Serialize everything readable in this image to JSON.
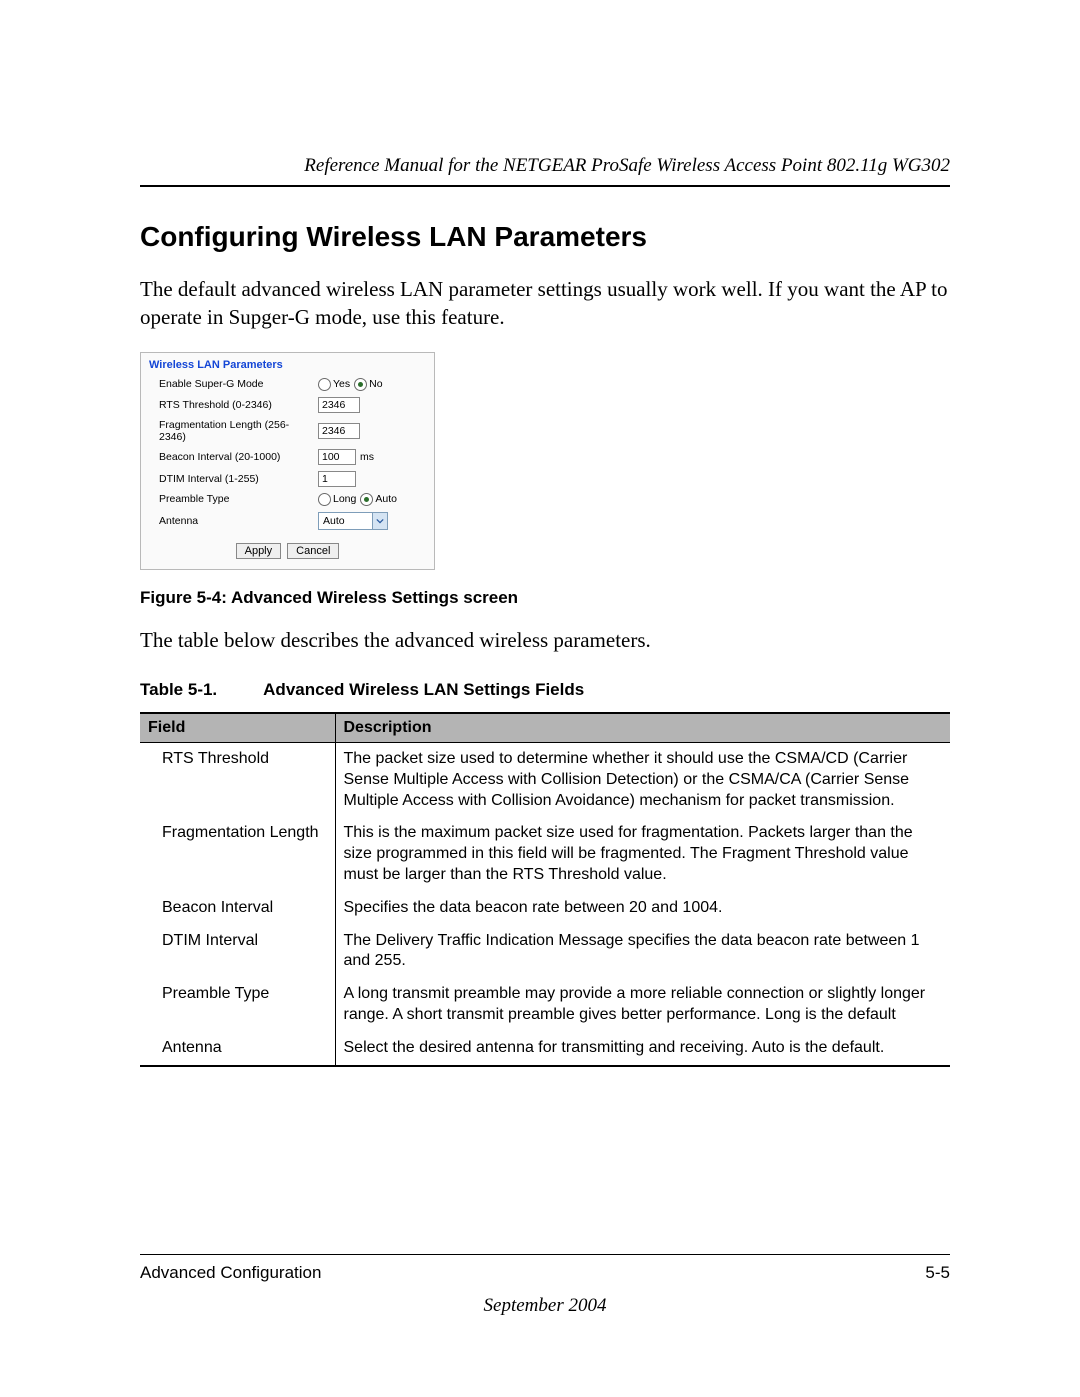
{
  "header": {
    "running_title": "Reference Manual for the NETGEAR ProSafe Wireless Access Point 802.11g WG302"
  },
  "heading": "Configuring Wireless LAN Parameters",
  "intro_para": "The default advanced wireless LAN parameter settings usually work well. If you want the AP to operate in Supger-G mode, use this feature.",
  "panel": {
    "title": "Wireless LAN Parameters",
    "rows": {
      "super_g": {
        "label": "Enable Super-G Mode",
        "yes": "Yes",
        "no": "No"
      },
      "rts": {
        "label": "RTS Threshold (0-2346)",
        "value": "2346"
      },
      "frag": {
        "label": "Fragmentation Length (256-2346)",
        "value": "2346"
      },
      "beacon": {
        "label": "Beacon Interval (20-1000)",
        "value": "100",
        "unit": "ms"
      },
      "dtim": {
        "label": "DTIM Interval (1-255)",
        "value": "1"
      },
      "preamble": {
        "label": "Preamble Type",
        "long": "Long",
        "auto": "Auto"
      },
      "antenna": {
        "label": "Antenna",
        "value": "Auto"
      }
    },
    "buttons": {
      "apply": "Apply",
      "cancel": "Cancel"
    }
  },
  "figure_caption": "Figure 5-4: Advanced Wireless Settings screen",
  "table_intro": "The table below describes the advanced wireless parameters.",
  "table_caption": {
    "num": "Table 5-1.",
    "title": "Advanced Wireless LAN Settings Fields"
  },
  "table": {
    "headers": {
      "field": "Field",
      "description": "Description"
    },
    "rows": [
      {
        "field": "RTS Threshold",
        "desc": "The packet size used to determine whether it should use the CSMA/CD (Carrier Sense Multiple Access with Collision Detection) or the CSMA/CA (Carrier Sense Multiple Access with Collision Avoidance) mechanism for packet transmission."
      },
      {
        "field": "Fragmentation Length",
        "desc": "This is the maximum packet size used for fragmentation. Packets larger than the size programmed in this field will be fragmented. The Fragment Threshold value must be larger than the RTS Threshold value."
      },
      {
        "field": "Beacon Interval",
        "desc": "Specifies the data beacon rate between 20 and 1004."
      },
      {
        "field": "DTIM Interval",
        "desc": "The Delivery Traffic Indication Message specifies the data beacon rate between 1 and 255."
      },
      {
        "field": "Preamble Type",
        "desc": "A long transmit preamble may provide a more reliable connection or slightly longer range. A short transmit preamble gives better performance. Long is the default"
      },
      {
        "field": "Antenna",
        "desc": "Select the desired antenna for transmitting and receiving. Auto is the default."
      }
    ]
  },
  "footer": {
    "section": "Advanced Configuration",
    "page": "5-5",
    "date": "September 2004"
  }
}
